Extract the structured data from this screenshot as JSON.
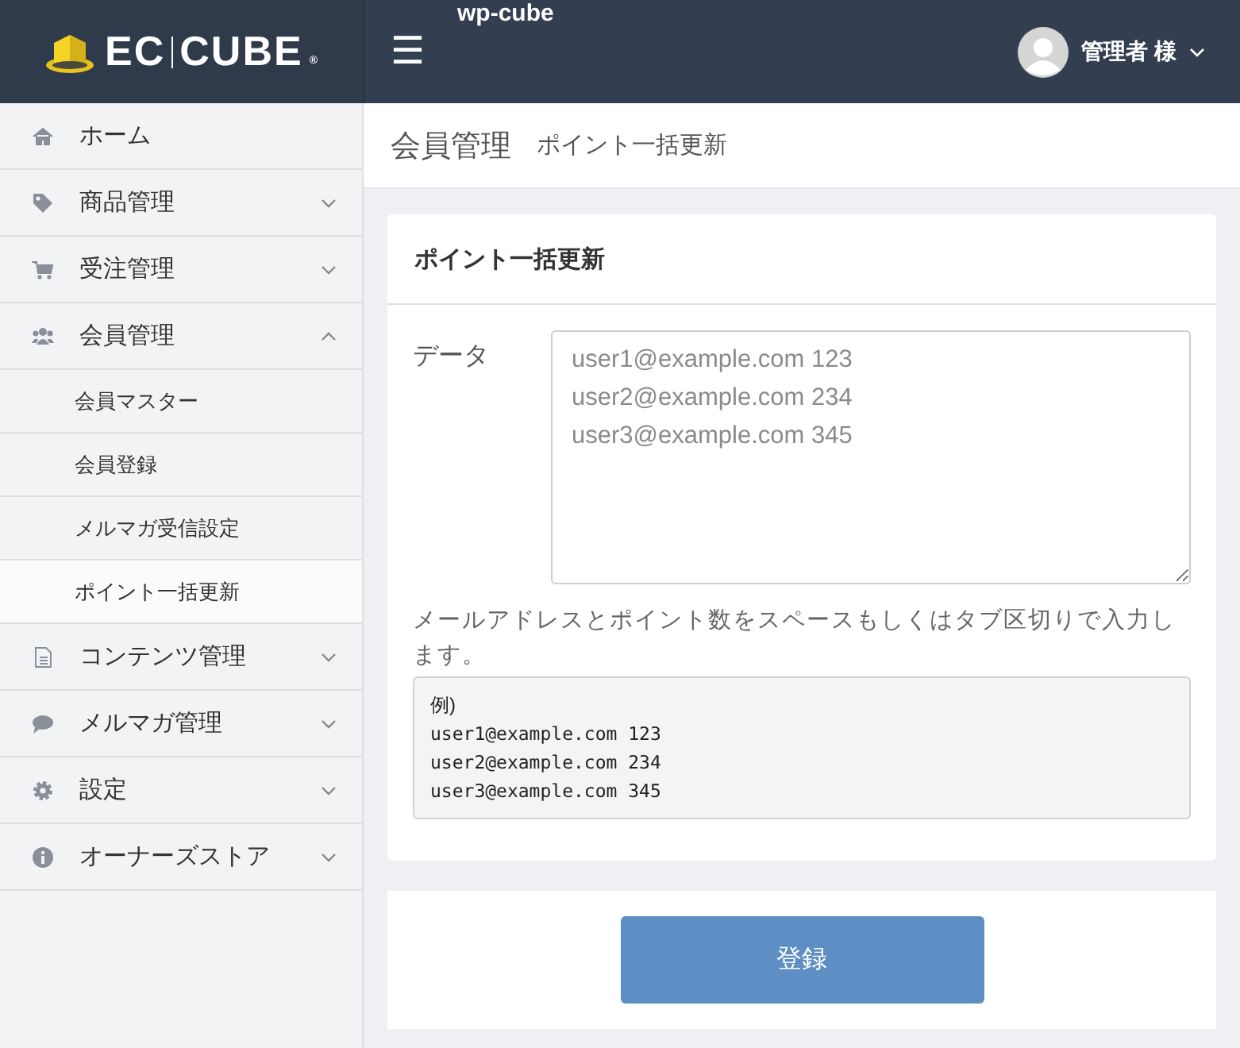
{
  "header": {
    "logo_left": "EC",
    "logo_right": "CUBE",
    "logo_mark": "®",
    "menu_icon": "☰",
    "site_name": "wp-cube",
    "user_name": "管理者 様"
  },
  "sidebar": {
    "items": [
      {
        "label": "ホーム"
      },
      {
        "label": "商品管理",
        "expanded": false
      },
      {
        "label": "受注管理",
        "expanded": false
      },
      {
        "label": "会員管理",
        "expanded": true,
        "children": [
          {
            "label": "会員マスター",
            "selected": false
          },
          {
            "label": "会員登録",
            "selected": false
          },
          {
            "label": "メルマガ受信設定",
            "selected": false
          },
          {
            "label": "ポイント一括更新",
            "selected": true
          }
        ]
      },
      {
        "label": "コンテンツ管理",
        "expanded": false
      },
      {
        "label": "メルマガ管理",
        "expanded": false
      },
      {
        "label": "設定",
        "expanded": false
      },
      {
        "label": "オーナーズストア",
        "expanded": false
      }
    ]
  },
  "page": {
    "title": "会員管理",
    "subtitle": "ポイント一括更新"
  },
  "card": {
    "title": "ポイント一括更新",
    "field_label": "データ",
    "field": {
      "placeholder": "user1@example.com 123\nuser2@example.com 234\nuser3@example.com 345"
    },
    "help": "メールアドレスとポイント数をスペースもしくはタブ区切りで入力します。",
    "example_heading": "例)",
    "example_lines": [
      "user1@example.com 123",
      "user2@example.com 234",
      "user3@example.com 345"
    ]
  },
  "submit_button": "登録"
}
